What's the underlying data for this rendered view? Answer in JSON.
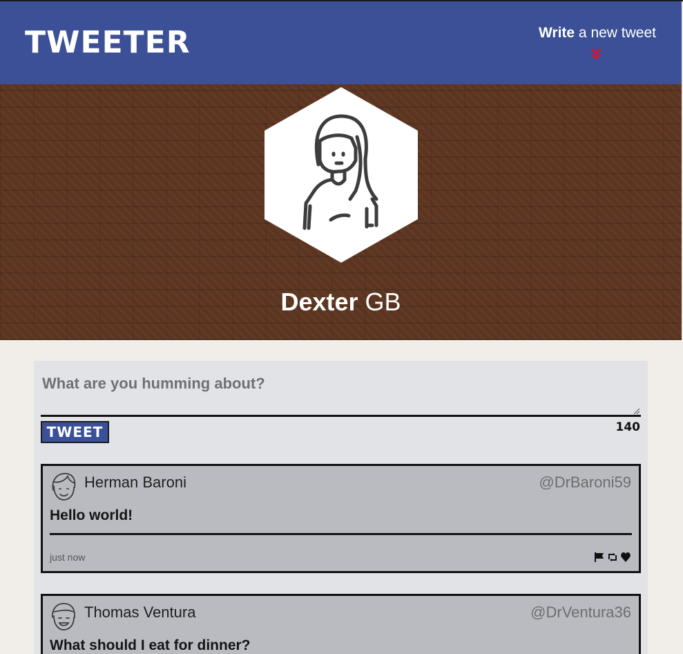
{
  "nav": {
    "brand": "TWEETER",
    "compose_bold": "Write",
    "compose_rest": " a new tweet",
    "compose_icon": "double-chevron-down-icon"
  },
  "profile": {
    "first_name": "Dexter",
    "last_name": "GB",
    "avatar_icon": "woman-avatar-icon"
  },
  "composer": {
    "placeholder": "What are you humming about?",
    "value": "",
    "button_label": "TWEET",
    "char_count": "140"
  },
  "tweets": [
    {
      "name": "Herman Baroni",
      "handle": "@DrBaroni59",
      "text": "Hello world!",
      "time": "just now",
      "actions": [
        "flag-icon",
        "retweet-icon",
        "heart-icon"
      ]
    },
    {
      "name": "Thomas Ventura",
      "handle": "@DrVentura36",
      "text": "What should I eat for dinner?"
    }
  ],
  "colors": {
    "nav_bg": "#3b5096",
    "header_brick": "#5c3521",
    "page_bg": "#f1eee9",
    "main_bg": "#e2e3e7",
    "tweet_bg": "#babbc0",
    "chevron": "#e0102a"
  }
}
